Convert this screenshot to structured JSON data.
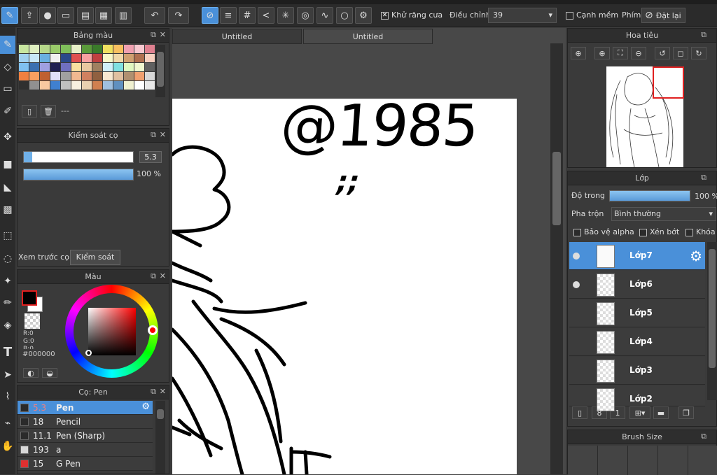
{
  "toolbar": {
    "antialias_label": "Khử răng cưa",
    "adjust_label": "Điều chỉnh",
    "adjust_value": "39",
    "soft_edge_label": "Cạnh mềm",
    "key_label": "Phím",
    "reset_label": "Đặt lại"
  },
  "palette_panel": {
    "title": "Bảng màu",
    "footer_text": "---",
    "colors": [
      "#c8e6a0",
      "#dff0c0",
      "#b7d98a",
      "#9acb6a",
      "#7fbf5a",
      "#e8f0c8",
      "#5a9a3a",
      "#3a7a2a",
      "#f0e060",
      "#f8c060",
      "#f0a0b0",
      "#f8c8d0",
      "#e08090",
      "#a0d0f0",
      "#c8e8f8",
      "#6ab0e0",
      "#f0f0f0",
      "#2a4a8a",
      "#e05050",
      "#f8a0a0",
      "#c04040",
      "#f8f8c8",
      "#f0d8a8",
      "#d0a070",
      "#b07050",
      "#f8d0c0",
      "#80c0f0",
      "#3a70b0",
      "#a0a0e0",
      "#202050",
      "#7070c0",
      "#f8e0a0",
      "#e8c8a0",
      "#a08060",
      "#d0f0f8",
      "#80e0e0",
      "#e0f8c0",
      "#f0f8d0",
      "#606060",
      "#f08040",
      "#f8a060",
      "#c06030",
      "#e0e0f8",
      "#a0a0a0",
      "#f0b890",
      "#d08060",
      "#906040",
      "#f8e8d0",
      "#e0c0a0",
      "#b09070",
      "#f0a070",
      "#d8d8d8",
      "#303030",
      "#909090",
      "#f8c8a0",
      "#4080d0",
      "#c0c0c0",
      "#f8f0e0",
      "#e8d0b0",
      "#d08050",
      "#a0c0e0",
      "#6090c0",
      "#f0f0d0",
      "#ffffff",
      "#e8e8e8"
    ]
  },
  "brush_control": {
    "title": "Kiểm soát cọ",
    "size_value": "5.3",
    "opacity_value": "100 %",
    "size_fraction": 0.08,
    "opacity_fraction": 1.0,
    "tab_preview": "Xem trước cọ",
    "tab_control": "Kiểm soát cọ"
  },
  "color_panel": {
    "title": "Màu",
    "r_label": "R:0",
    "g_label": "G:0",
    "b_label": "B:0",
    "hex_value": "#000000",
    "foreground": "#000000",
    "background": "#ffffff"
  },
  "brush_list": {
    "title": "Cọ: Pen",
    "items": [
      {
        "size": "5.3",
        "name": "Pen",
        "swatch": "#2a2a2a",
        "selected": true
      },
      {
        "size": "18",
        "name": "Pencil",
        "swatch": "#2a2a2a"
      },
      {
        "size": "11.1",
        "name": "Pen (Sharp)",
        "swatch": "#2a2a2a"
      },
      {
        "size": "193",
        "name": "a",
        "swatch": "#d8d8d8"
      },
      {
        "size": "15",
        "name": "G Pen",
        "swatch": "#e03030"
      }
    ]
  },
  "canvas": {
    "tabs": [
      "Untitled",
      "Untitled"
    ]
  },
  "navigator": {
    "title": "Hoa tiêu"
  },
  "layers_panel": {
    "title": "Lớp",
    "opacity_label": "Độ trong",
    "opacity_value": "100 %",
    "opacity_fraction": 1.0,
    "blend_label": "Pha trộn",
    "blend_value": "Bình thường",
    "protect_alpha": "Bảo vệ alpha",
    "clipping": "Xén bớt",
    "lock": "Khóa",
    "layers": [
      {
        "name": "Lớp7",
        "selected": true,
        "visible": true
      },
      {
        "name": "Lớp6",
        "visible": true
      },
      {
        "name": "Lớp5"
      },
      {
        "name": "Lớp4"
      },
      {
        "name": "Lớp3"
      },
      {
        "name": "Lớp2"
      }
    ]
  },
  "brush_size_panel": {
    "title": "Brush Size"
  },
  "artwork": {
    "signature": "@1985",
    "signature_mark": ";;"
  }
}
